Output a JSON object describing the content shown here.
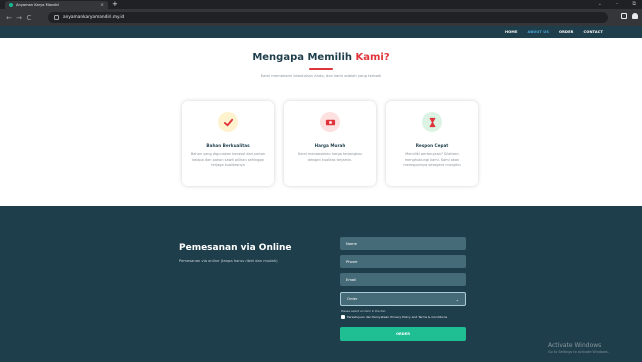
{
  "browser": {
    "tab_title": "Anyaman Karya Mandiri",
    "tab_close": "×",
    "new_tab": "+",
    "url": "anyamankaryamandiri.my.id",
    "back": "←",
    "forward": "→",
    "reload": "C",
    "site_icon": "site-info-icon",
    "window_controls": [
      "⌄",
      "–",
      "⧉"
    ]
  },
  "nav": {
    "items": [
      {
        "label": "HOME",
        "active": false
      },
      {
        "label": "ABOUT US",
        "active": true
      },
      {
        "label": "ORDER",
        "active": false
      },
      {
        "label": "CONTACT",
        "active": false
      }
    ]
  },
  "why": {
    "title_main": "Mengapa Memilih ",
    "title_highlight": "Kami?",
    "subtitle": "Kami memahami kebutuhan Anda, dan kami adalah yang terbaik",
    "cards": [
      {
        "icon": "check-icon",
        "title": "Bahan Berkualitas",
        "text": "Bahan yang digunakan berasal dari pohon kelapa dan pohon sawit pilihan sehingga terjaga kualitasnya",
        "color": "#e0343d",
        "bg": "#fff3cf"
      },
      {
        "icon": "money-icon",
        "title": "Harga Murah",
        "text": "Kami menawarkan harga terjangkau dengan kualitas terjamin.",
        "color": "#e0343d",
        "bg": "#fde0e0"
      },
      {
        "icon": "hourglass-icon",
        "title": "Respon Cepat",
        "text": "Memiliki pertanyaan? Silahkan menghubungi kami. Kami akan meresponnya sesegera mungkin",
        "color": "#e0343d",
        "bg": "#dcf3e4"
      }
    ]
  },
  "order": {
    "title": "Pemesanan via Online",
    "subtitle": "Pemesanan via online (tanpa harus ribet dan mudah)",
    "fields": {
      "name_placeholder": "Name",
      "phone_placeholder": "Phone",
      "email_placeholder": "Email"
    },
    "select_value": "Order",
    "hint": "Please select an item in the list.",
    "consent": "Persetujuan dan Pernyataan Privacy Policy and Terms & Conditions",
    "button_label": "ORDER"
  },
  "watermark": {
    "title": "Activate Windows",
    "subtitle": "Go to Settings to activate Windows."
  },
  "colors": {
    "navy": "#1f3e4b",
    "accent_red": "#e0343d",
    "green_button": "#1fbf93",
    "active_nav": "#4aa8d8"
  }
}
